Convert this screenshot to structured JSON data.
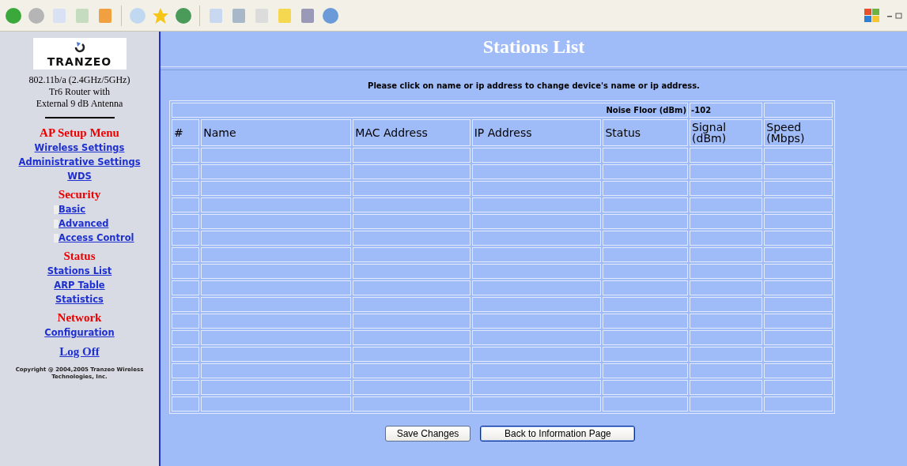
{
  "sidebar": {
    "logo": "TRANZEO",
    "device": [
      "802.11b/a (2.4GHz/5GHz)",
      "Tr6 Router with",
      "External 9 dB Antenna"
    ],
    "sections": [
      {
        "heading": "AP Setup Menu",
        "items": [
          {
            "label": "Wireless Settings",
            "kind": "link"
          },
          {
            "label": "Administrative Settings",
            "kind": "link"
          },
          {
            "label": "WDS",
            "kind": "link"
          }
        ]
      },
      {
        "heading": "Security",
        "items": [
          {
            "label": "Basic",
            "kind": "bullet"
          },
          {
            "label": "Advanced",
            "kind": "bullet"
          },
          {
            "label": "Access Control",
            "kind": "bullet"
          }
        ]
      },
      {
        "heading": "Status",
        "items": [
          {
            "label": "Stations List",
            "kind": "link"
          },
          {
            "label": "ARP Table",
            "kind": "link"
          },
          {
            "label": "Statistics",
            "kind": "link"
          }
        ]
      },
      {
        "heading": "Network",
        "items": [
          {
            "label": "Configuration",
            "kind": "link"
          }
        ]
      }
    ],
    "logoff": "Log Off",
    "copyright": "Copyright @ 2004,2005 Tranzeo Wireless Technologies, Inc."
  },
  "page": {
    "title": "Stations List",
    "instruction": "Please click on name or ip address to change device's name or ip address.",
    "noise_floor": {
      "label": "Noise Floor (dBm)",
      "value": "-102"
    },
    "table": {
      "columns": [
        "#",
        "Name",
        "MAC Address",
        "IP Address",
        "Status",
        "Signal (dBm)",
        "Speed (Mbps)"
      ]
    },
    "buttons": [
      "Save Changes",
      "Back to Information Page"
    ]
  }
}
